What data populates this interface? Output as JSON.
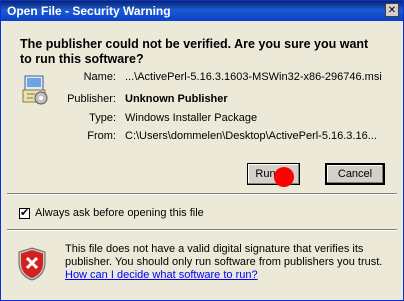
{
  "window": {
    "title": "Open File - Security Warning"
  },
  "headline": "The publisher could not be verified.  Are you sure you want to run this software?",
  "details": [
    {
      "label": "Name:",
      "value": "...\\ActivePerl-5.16.3.1603-MSWin32-x86-296746.msi",
      "bold": false
    },
    {
      "label": "Publisher:",
      "value": "Unknown Publisher",
      "bold": true
    },
    {
      "label": "Type:",
      "value": "Windows Installer Package",
      "bold": false
    },
    {
      "label": "From:",
      "value": "C:\\Users\\dommelen\\Desktop\\ActivePerl-5.16.3.16...",
      "bold": false
    }
  ],
  "buttons": {
    "run_label": "Run",
    "cancel_label": "Cancel"
  },
  "checkbox": {
    "label": "Always ask before opening this file",
    "checked": true
  },
  "warning": {
    "text": "This file does not have a valid digital signature that verifies its publisher.  You should only run software from publishers you trust.",
    "link_text": "How can I decide what software to run?"
  },
  "colors": {
    "title_bar": "#0a246a",
    "dialog_bg": "#ece9d8",
    "link": "#0000ff",
    "marker": "#ff0000"
  },
  "icons": {
    "installer": "installer-package-icon",
    "shield": "shield-error-icon",
    "close": "close-icon"
  }
}
